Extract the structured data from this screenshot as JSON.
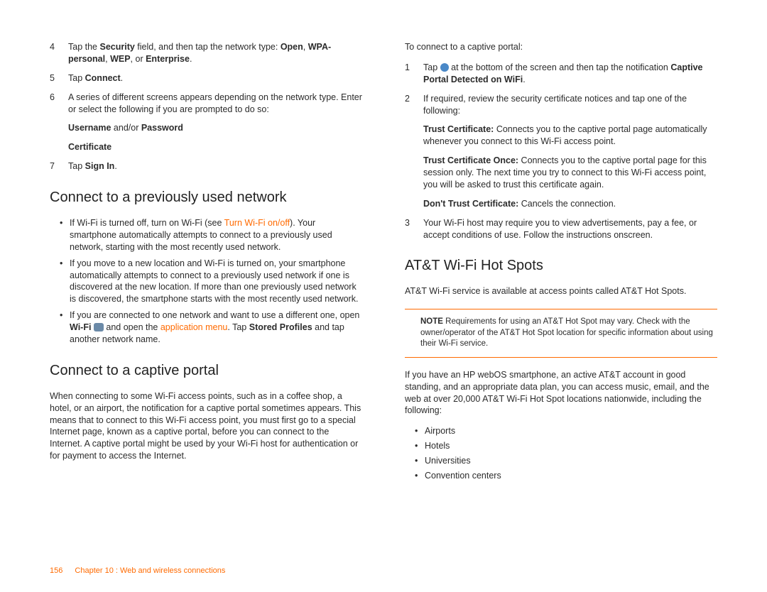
{
  "left": {
    "step4": {
      "num": "4",
      "pre": "Tap the ",
      "b1": "Security",
      "mid": " field, and then tap the network type: ",
      "b2": "Open",
      "c1": ", ",
      "b3": "WPA-personal",
      "c2": ", ",
      "b4": "WEP",
      "c3": ", or ",
      "b5": "Enterprise",
      "post": "."
    },
    "step5": {
      "num": "5",
      "pre": "Tap ",
      "b": "Connect",
      "post": "."
    },
    "step6": {
      "num": "6",
      "text": "A series of different screens appears depending on the network type. Enter or select the following if you are prompted to do so:"
    },
    "sub1": {
      "b1": "Username",
      "mid": " and/or ",
      "b2": "Password"
    },
    "sub2": {
      "b": "Certificate"
    },
    "step7": {
      "num": "7",
      "pre": "Tap ",
      "b": "Sign In",
      "post": "."
    },
    "h_prev": "Connect to a previously used network",
    "prev_b1": {
      "pre": "If Wi-Fi is turned off, turn on Wi-Fi (see ",
      "link": "Turn Wi-Fi on/off",
      "post": "). Your smartphone automatically attempts to connect to a previously used network, starting with the most recently used network."
    },
    "prev_b2": "If you move to a new location and Wi-Fi is turned on, your smartphone automatically attempts to connect to a previously used network if one is discovered at the new location. If more than one previously used network is discovered, the smartphone starts with the most recently used network.",
    "prev_b3": {
      "pre": "If you are connected to one network and want to use a different one, open ",
      "b1": "Wi-Fi",
      "icon": "wifi-icon",
      "mid": " and open the ",
      "link": "application menu",
      "post1": ". Tap ",
      "b2": "Stored Profiles",
      "post2": " and tap another network name."
    },
    "h_captive": "Connect to a captive portal",
    "captive_intro": "When connecting to some Wi-Fi access points, such as in a coffee shop, a hotel, or an airport, the notification for a captive portal sometimes appears. This means that to connect to this Wi-Fi access point, you must first go to a special Internet page, known as a captive portal, before you can connect to the Internet. A captive portal might be used by your Wi-Fi host for authentication or for payment to access the Internet."
  },
  "right": {
    "captive_lead": "To connect to a captive portal:",
    "s1": {
      "num": "1",
      "pre": "Tap ",
      "icon": "globe-icon",
      "mid": " at the bottom of the screen and then tap the notification ",
      "b": "Captive Portal Detected on WiFi",
      "post": "."
    },
    "s2": {
      "num": "2",
      "text": "If required, review the security certificate notices and tap one of the following:"
    },
    "opt1": {
      "b": "Trust Certificate:",
      "text": " Connects you to the captive portal page automatically whenever you connect to this Wi-Fi access point."
    },
    "opt2": {
      "b": "Trust Certificate Once:",
      "text": " Connects you to the captive portal page for this session only. The next time you try to connect to this Wi-Fi access point, you will be asked to trust this certificate again."
    },
    "opt3": {
      "b": "Don't Trust Certificate:",
      "text": " Cancels the connection."
    },
    "s3": {
      "num": "3",
      "text": "Your Wi-Fi host may require you to view advertisements, pay a fee, or accept conditions of use. Follow the instructions onscreen."
    },
    "h_att": "AT&T Wi-Fi Hot Spots",
    "att_p1": "AT&T Wi-Fi service is available at access points called AT&T Hot Spots.",
    "note": {
      "b": "NOTE",
      "text": "  Requirements for using an AT&T Hot Spot may vary. Check with the owner/operator of the AT&T Hot Spot location for specific information about using their Wi-Fi service."
    },
    "att_p2": "If you have an HP webOS smartphone, an active AT&T account in good standing, and an appropriate data plan, you can access music, email, and the web at over 20,000 AT&T Wi-Fi Hot Spot locations nationwide, including the following:",
    "loc1": "Airports",
    "loc2": "Hotels",
    "loc3": "Universities",
    "loc4": "Convention centers"
  },
  "footer": {
    "page": "156",
    "chapter": "Chapter 10 : Web and wireless connections"
  }
}
